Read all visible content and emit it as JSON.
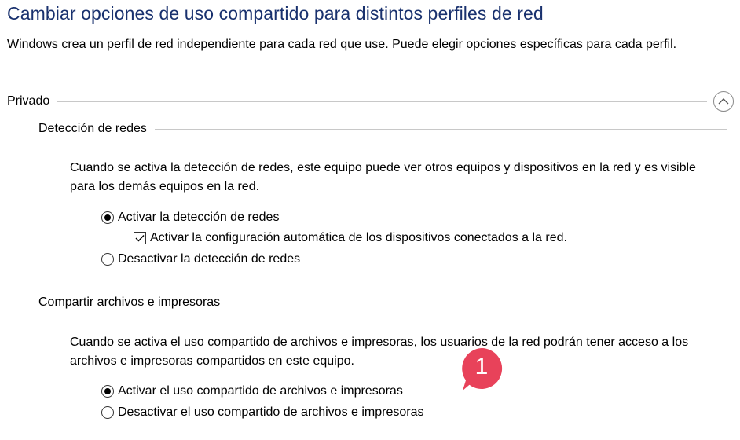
{
  "page": {
    "title": "Cambiar opciones de uso compartido para distintos perfiles de red",
    "intro": "Windows crea un perfil de red independiente para cada red que use. Puede elegir opciones específicas para cada perfil."
  },
  "profile": {
    "name": "Privado",
    "collapse_icon": "chevron-up-icon"
  },
  "network_discovery": {
    "heading": "Detección de redes",
    "description": "Cuando se activa la detección de redes, este equipo puede ver otros equipos y dispositivos en la red y es visible para los demás equipos en la red.",
    "options": [
      {
        "label": "Activar la detección de redes",
        "selected": true
      },
      {
        "label": "Desactivar la detección de redes",
        "selected": false
      }
    ],
    "auto_setup": {
      "label": "Activar la configuración automática de los dispositivos conectados a la red.",
      "checked": true
    }
  },
  "file_printer_sharing": {
    "heading": "Compartir archivos e impresoras",
    "description": "Cuando se activa el uso compartido de archivos e impresoras, los usuarios de la red podrán tener acceso a los archivos e impresoras compartidos en este equipo.",
    "options": [
      {
        "label": "Activar el uso compartido de archivos e impresoras",
        "selected": true
      },
      {
        "label": "Desactivar el uso compartido de archivos e impresoras",
        "selected": false
      }
    ]
  },
  "annotation": {
    "number": "1",
    "color": "#e8425a"
  },
  "colors": {
    "title": "#19316e",
    "rule": "#c8c8c8"
  }
}
